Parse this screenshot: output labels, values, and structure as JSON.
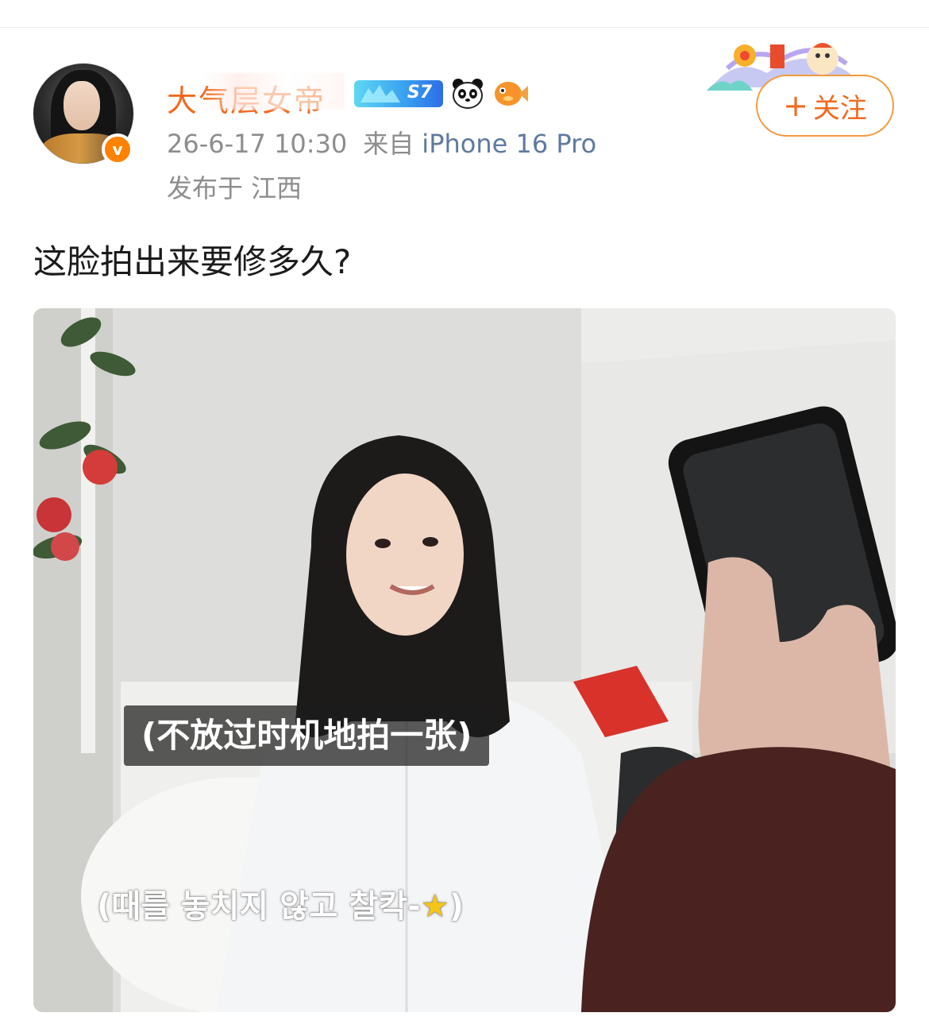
{
  "user": {
    "nickname": "大气层女帝",
    "verified_badge": "v",
    "level_badge": "S7",
    "badge_icons": [
      "panda-icon",
      "fish-icon"
    ]
  },
  "post": {
    "timestamp": "26-6-17 10:30",
    "source_prefix": "来自",
    "device": "iPhone 16 Pro",
    "location": "发布于 江西",
    "text": "这脸拍出来要修多久?"
  },
  "follow_button": {
    "plus": "+",
    "label": "关注"
  },
  "media": {
    "caption_zh": "(不放过时机地拍一张)",
    "caption_ko": "(때를 놓치지 않고 찰칵-",
    "caption_ko_end": ")",
    "caption_star": "★"
  },
  "colors": {
    "accent_orange": "#f06a1f",
    "follow_border": "#f39a3d",
    "meta_gray": "#8d8d8d",
    "device_blue": "#5f7a9e"
  }
}
